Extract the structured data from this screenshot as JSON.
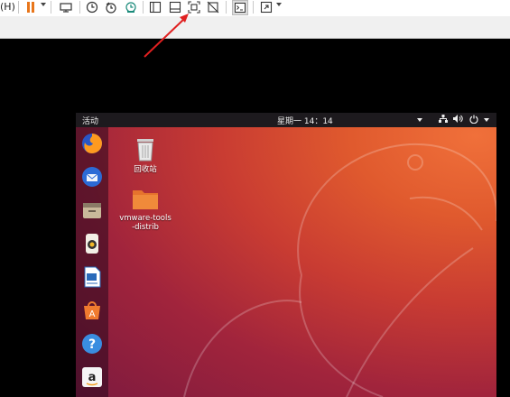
{
  "toolbar": {
    "menu_fragment": "(H)",
    "icons": [
      "pause-icon",
      "send-keys-icon",
      "snapshot-icon",
      "snapshot-restore-icon",
      "snapshot-manager-icon",
      "show-library-icon",
      "thumbnail-bar-icon",
      "fit-guest-icon",
      "no-frame-icon",
      "console-view-icon",
      "fullscreen-icon"
    ]
  },
  "colors": {
    "arrow": "#e02020",
    "pause": "#e8761b",
    "topbar": "#1d1a1e",
    "desktop_accent": "#e05a2e"
  },
  "ubuntu": {
    "activities": "活动",
    "clock": "星期一 14：14",
    "system_icons": [
      "network-icon",
      "volume-icon",
      "power-icon"
    ],
    "dock": [
      "firefox-icon",
      "thunderbird-icon",
      "files-icon",
      "rhythmbox-icon",
      "writer-icon",
      "software-center-icon",
      "help-icon",
      "amazon-icon"
    ],
    "desktop_items": [
      {
        "label": "回收站",
        "icon": "trash-icon"
      },
      {
        "label": "vmware-tools-distrib",
        "icon": "folder-icon"
      }
    ]
  }
}
